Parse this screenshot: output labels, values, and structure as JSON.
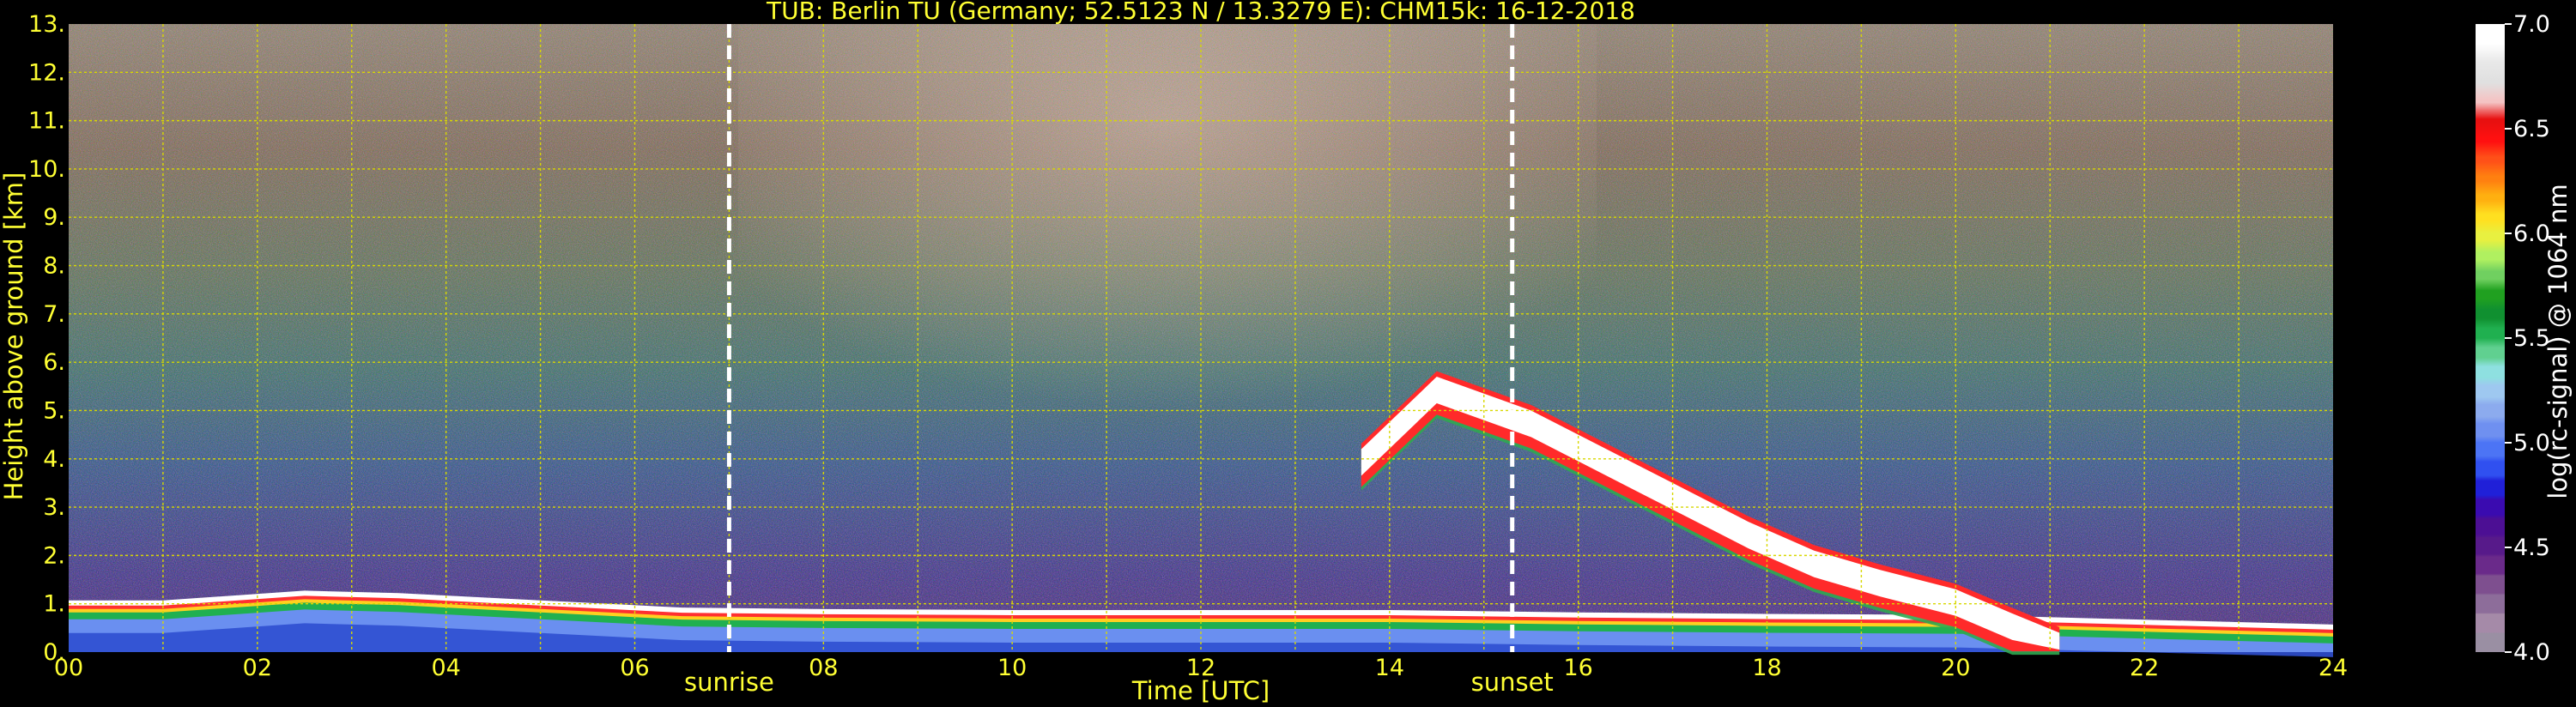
{
  "chart_data": {
    "type": "heatmap",
    "title": "TUB: Berlin TU (Germany; 52.5123 N / 13.3279 E):    CHM15k: 16-12-2018",
    "xlabel": "Time [UTC]",
    "ylabel": "Height above ground [km]",
    "x_ticks": [
      "00",
      "02",
      "04",
      "06",
      "08",
      "10",
      "12",
      "14",
      "16",
      "18",
      "20",
      "22",
      "24"
    ],
    "x_tick_values": [
      0,
      2,
      4,
      6,
      8,
      10,
      12,
      14,
      16,
      18,
      20,
      22,
      24
    ],
    "y_ticks": [
      "0.",
      "1.",
      "2.",
      "3.",
      "4.",
      "5.",
      "6.",
      "7.",
      "8.",
      "9.",
      "10.",
      "11.",
      "12.",
      "13."
    ],
    "y_tick_values": [
      0,
      1,
      2,
      3,
      4,
      5,
      6,
      7,
      8,
      9,
      10,
      11,
      12,
      13
    ],
    "xlim": [
      0,
      24
    ],
    "ylim": [
      0,
      13
    ],
    "grid": true,
    "colorbar": {
      "label": "log(rc-signal) @ 1064 nm",
      "range": [
        4.0,
        7.0
      ],
      "ticks": [
        "4.0",
        "4.5",
        "5.0",
        "5.5",
        "6.0",
        "6.5",
        "7.0"
      ],
      "tick_values": [
        4.0,
        4.5,
        5.0,
        5.5,
        6.0,
        6.5,
        7.0
      ],
      "colors": [
        "#9a8fa3",
        "#a58aa8",
        "#8d6d9a",
        "#7e4f8f",
        "#6a2a8a",
        "#571a8a",
        "#4c0f94",
        "#3a0bb0",
        "#2020d8",
        "#3050f0",
        "#4c74f5",
        "#6f90f0",
        "#8cabee",
        "#9ec8f0",
        "#8ee0e0",
        "#60d090",
        "#20b050",
        "#109030",
        "#20a020",
        "#70d060",
        "#b0f060",
        "#e8f040",
        "#ffe020",
        "#ffb010",
        "#ff8010",
        "#ff5018",
        "#ff1010",
        "#e81010",
        "#f4c4c4",
        "#e0e0e0",
        "#e8e8e8",
        "#ffffff",
        "#ffffff"
      ]
    },
    "events": [
      {
        "label": "sunrise",
        "time": 7.0
      },
      {
        "label": "sunset",
        "time": 15.3
      }
    ],
    "features": {
      "boundary_layer": [
        [
          0,
          1.0
        ],
        [
          1,
          1.0
        ],
        [
          2.5,
          1.2
        ],
        [
          3.5,
          1.15
        ],
        [
          5,
          1.0
        ],
        [
          6.5,
          0.85
        ],
        [
          8,
          0.82
        ],
        [
          10,
          0.8
        ],
        [
          12,
          0.8
        ],
        [
          14,
          0.8
        ],
        [
          16,
          0.75
        ],
        [
          18,
          0.72
        ],
        [
          20,
          0.7
        ],
        [
          22,
          0.6
        ],
        [
          24,
          0.5
        ]
      ],
      "cloud_layer": [
        [
          13.7,
          4.0
        ],
        [
          14.5,
          5.5
        ],
        [
          15.5,
          4.8
        ],
        [
          16.3,
          4.0
        ],
        [
          17,
          3.3
        ],
        [
          17.8,
          2.5
        ],
        [
          18.5,
          1.9
        ],
        [
          19.2,
          1.5
        ],
        [
          20,
          1.1
        ],
        [
          20.6,
          0.6
        ],
        [
          21.1,
          0.2
        ]
      ]
    }
  },
  "colors": {
    "background": "#000000",
    "text": "#ffff33",
    "grid": "#d8d800",
    "event_line": "#ffffff"
  }
}
